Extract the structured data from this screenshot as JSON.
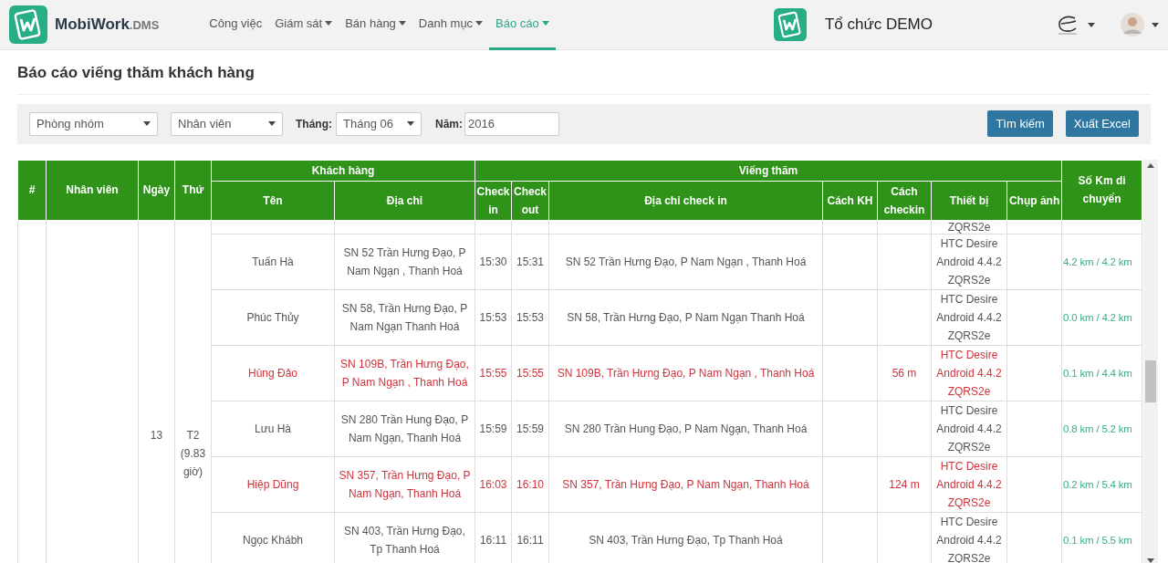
{
  "header": {
    "brand": "MobiWork",
    "brand_suffix": ".DMS",
    "nav": [
      {
        "label": "Công việc",
        "dropdown": false,
        "selected": false
      },
      {
        "label": "Giám sát",
        "dropdown": true,
        "selected": false
      },
      {
        "label": "Bán hàng",
        "dropdown": true,
        "selected": false
      },
      {
        "label": "Danh mục",
        "dropdown": true,
        "selected": false
      },
      {
        "label": "Báo cáo",
        "dropdown": true,
        "selected": true
      }
    ],
    "org": "Tổ chức DEMO"
  },
  "page_title": "Báo cáo viếng thăm khách hàng",
  "filters": {
    "group": "Phòng nhóm",
    "staff": "Nhân viên",
    "month_label": "Tháng:",
    "month": "Tháng 06",
    "year_label": "Năm:",
    "year": "2016"
  },
  "buttons": [
    "Tìm kiếm",
    "Xuất Excel"
  ],
  "table": {
    "columns": [
      {
        "label": "#"
      },
      {
        "label": "Nhân viên"
      },
      {
        "label": "Ngày"
      },
      {
        "label": "Thứ"
      },
      {
        "label": "Khách hàng",
        "children": [
          "Tên",
          "Địa chỉ"
        ]
      },
      {
        "label": "Viếng thăm",
        "children": [
          "Check in",
          "Check out",
          "Địa chỉ check in",
          "Cách KH",
          "Cách checkin",
          "Thiết bị",
          "Chụp ảnh"
        ]
      },
      {
        "label": "Số Km di chuyển"
      }
    ],
    "day": "13",
    "weekday": "T2 (9.83 giờ)",
    "partial_row": {
      "device": "ZQRS2e"
    },
    "rows": [
      {
        "name": "Tuấn Hà",
        "address": "SN 52 Trần Hưng Đạo, P Nam Ngạn , Thanh Hoá",
        "check_in": "15:30",
        "check_out": "15:31",
        "checkin_address": "SN 52 Trần Hưng Đạo, P Nam Ngạn , Thanh Hoá",
        "device": [
          "HTC Desire",
          "Android 4.4.2",
          "ZQRS2e"
        ],
        "km": "4.2 km / 4.2 km",
        "flagged": false
      },
      {
        "name": "Phúc Thủy",
        "address": "SN 58, Trần Hưng Đạo, P Nam Ngạn Thanh Hoá",
        "check_in": "15:53",
        "check_out": "15:53",
        "checkin_address": "SN 58, Trần Hưng Đạo, P Nam Ngạn Thanh Hoá",
        "device": [
          "HTC Desire",
          "Android 4.4.2",
          "ZQRS2e"
        ],
        "km": "0.0 km / 4.2 km",
        "flagged": false
      },
      {
        "name": "Hùng Đảo",
        "address": "SN 109B, Trần Hưng Đạo, P Nam Ngạn , Thanh Hoá",
        "check_in": "15:55",
        "check_out": "15:55",
        "checkin_address": "SN 109B, Trần Hưng Đạo, P Nam Ngạn , Thanh Hoá",
        "distance": "56 m",
        "device": [
          "HTC Desire",
          "Android 4.4.2",
          "ZQRS2e"
        ],
        "km": "0.1 km / 4.4 km",
        "flagged": true
      },
      {
        "name": "Lưu Hà",
        "address": "SN 280 Trần Hung Đạo, P Nam Ngạn, Thanh Hoá",
        "check_in": "15:59",
        "check_out": "15:59",
        "checkin_address": "SN 280 Trần Hung Đạo, P Nam Ngạn, Thanh Hoá",
        "device": [
          "HTC Desire",
          "Android 4.4.2",
          "ZQRS2e"
        ],
        "km": "0.8 km / 5.2 km",
        "flagged": false
      },
      {
        "name": "Hiệp Dũng",
        "address": "SN 357, Trần Hưng Đạo, P Nam Ngạn, Thanh Hoá",
        "check_in": "16:03",
        "check_out": "16:10",
        "checkin_address": "SN 357, Trần Hưng Đạo, P Nam Ngạn, Thanh Hoá",
        "distance": "124 m",
        "device": [
          "HTC Desire",
          "Android 4.4.2",
          "ZQRS2e"
        ],
        "km": "0.2 km / 5.4 km",
        "flagged": true
      },
      {
        "name": "Ngọc Khábh",
        "address": "SN 403, Trần Hưng Đạo, Tp Thanh Hoá",
        "check_in": "16:11",
        "check_out": "16:11",
        "checkin_address": "SN 403, Trần Hưng Đạo, Tp Thanh Hoá",
        "device": [
          "HTC Desire",
          "Android 4.4.2",
          "ZQRS2e"
        ],
        "km": "0.1 km / 5.5 km",
        "flagged": false
      }
    ]
  }
}
